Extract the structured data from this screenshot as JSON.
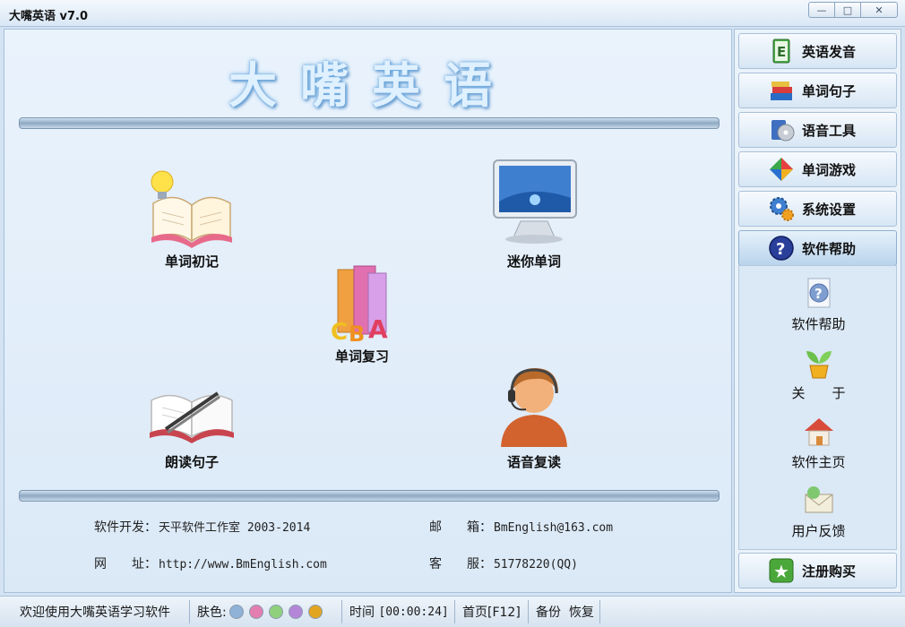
{
  "window": {
    "title": "大嘴英语 v7.0"
  },
  "logo": {
    "text": "大嘴英语"
  },
  "tiles": {
    "word_memorize": "单词初记",
    "mini_words": "迷你单词",
    "word_review": "单词复习",
    "read_sentences": "朗读句子",
    "voice_repeat": "语音复读"
  },
  "info": {
    "dev_label": "软件开发：",
    "dev_value": "天平软件工作室 2003-2014",
    "mail_label": "邮　　箱：",
    "mail_value": "BmEnglish@163.com",
    "site_label": "网　　址：",
    "site_value": "http://www.BmEnglish.com",
    "service_label": "客　　服：",
    "service_value": "51778220(QQ)"
  },
  "sidebar": {
    "items": [
      {
        "label": "英语发音",
        "icon": "book-e-icon"
      },
      {
        "label": "单词句子",
        "icon": "books-stack-icon"
      },
      {
        "label": "语音工具",
        "icon": "audio-disc-icon"
      },
      {
        "label": "单词游戏",
        "icon": "puzzle-icon"
      },
      {
        "label": "系统设置",
        "icon": "gears-icon"
      },
      {
        "label": "软件帮助",
        "icon": "help-circle-icon"
      }
    ],
    "sub_items": [
      {
        "label": "软件帮助",
        "icon": "help-doc-icon"
      },
      {
        "label": "关　　于",
        "icon": "plant-icon"
      },
      {
        "label": "软件主页",
        "icon": "house-icon"
      },
      {
        "label": "用户反馈",
        "icon": "mail-feedback-icon"
      }
    ],
    "register": "注册购买"
  },
  "status": {
    "welcome": "欢迎使用大嘴英语学习软件",
    "skin_label": "肤色:",
    "time_label": "时间",
    "time_value": "[00:00:24]",
    "home": "首页[F12]",
    "backup": "备份",
    "restore": "恢复",
    "skin_colors": [
      "#8fb2d6",
      "#e27fb0",
      "#8fd07d",
      "#b486d8",
      "#e2a520"
    ]
  },
  "colors": {
    "accent": "#2a63b8",
    "panel": "#dbe9f7"
  }
}
